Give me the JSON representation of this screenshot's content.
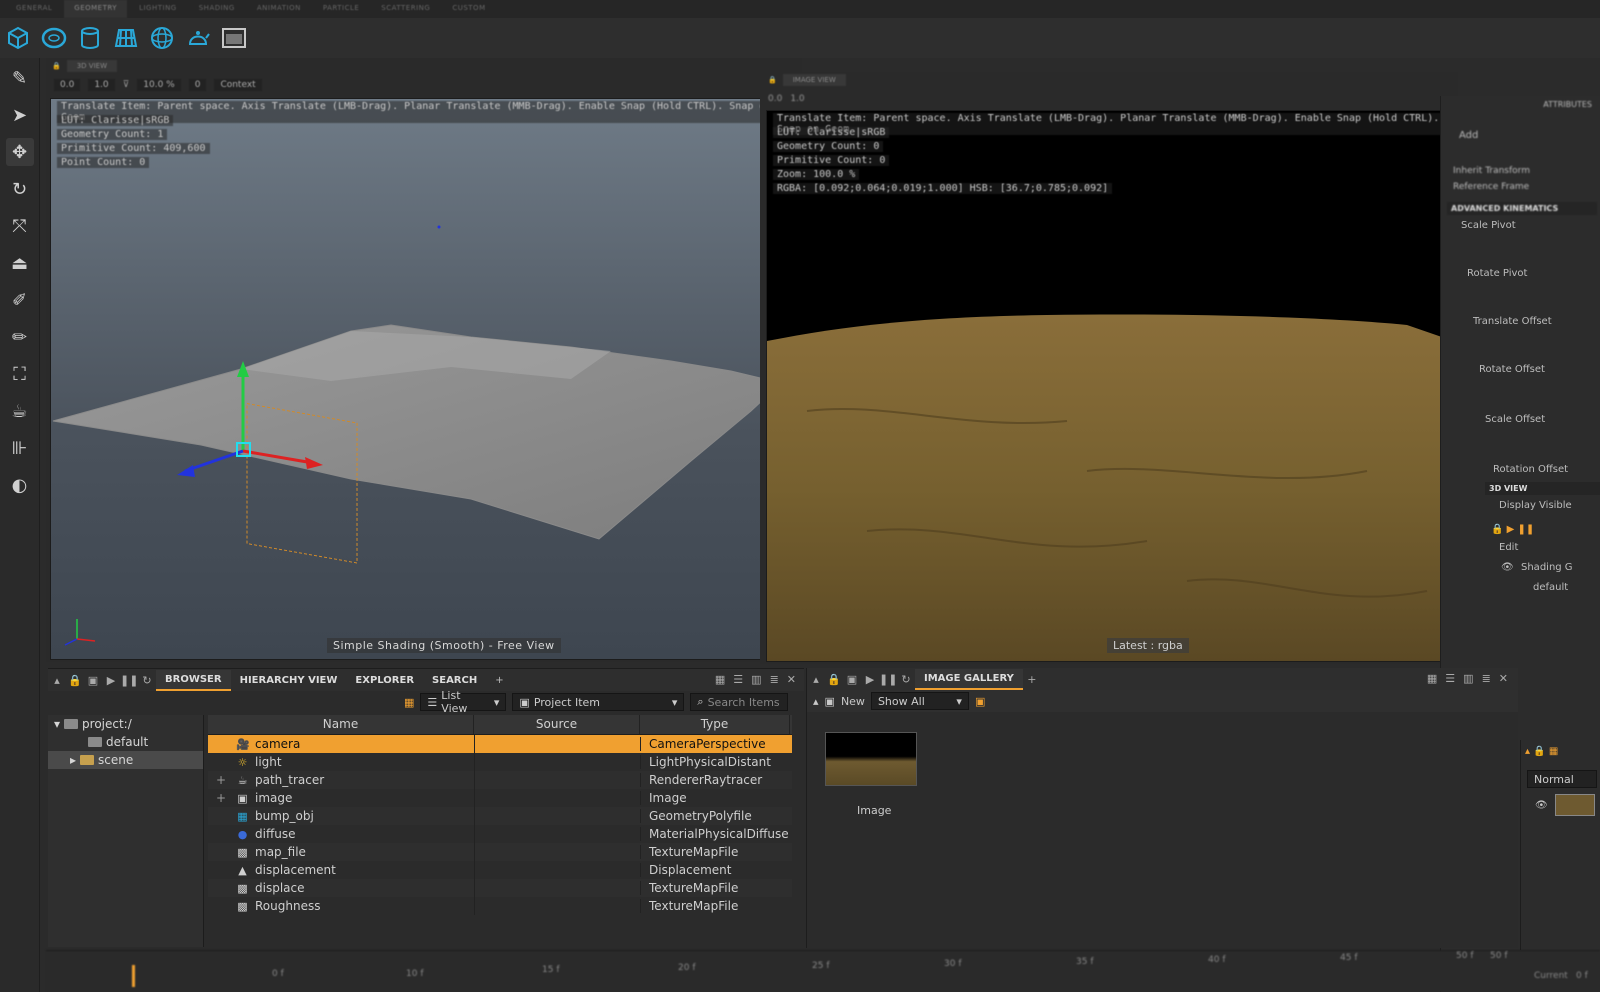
{
  "shelf_tabs": [
    "GENERAL",
    "GEOMETRY",
    "LIGHTING",
    "SHADING",
    "ANIMATION",
    "PARTICLE",
    "SCATTERING",
    "CUSTOM"
  ],
  "shelf_icons": [
    "cube-icon",
    "torus-icon",
    "cylinder-icon",
    "grid-icon",
    "sphere-icon",
    "teapot-icon",
    "render-icon"
  ],
  "left_tools": [
    "pen-icon",
    "select-arrow-icon",
    "move-icon",
    "rotate-icon",
    "scale-icon",
    "stamp-icon",
    "paint-icon",
    "brush-icon",
    "frame-icon",
    "teapot-icon",
    "ruler-icon",
    "color-swatch-icon"
  ],
  "view3d": {
    "tab_label": "3D VIEW",
    "toolbar": {
      "value1": "0.0",
      "value2": "1.0",
      "zoom": "10.0 %",
      "frame": "0",
      "context": "Context"
    },
    "overlay": [
      "Translate Item: Parent space. Axis Translate (LMB-Drag). Planar Translate (MMB-Drag). Enable Snap (Hold CTRL). Snap on Geom",
      "LUT: Clarisse|sRGB",
      "Geometry Count: 1",
      "Primitive Count: 409,600",
      "Point Count: 0"
    ],
    "caption": "Simple Shading (Smooth) - Free View"
  },
  "viewimg": {
    "tab_label": "IMAGE VIEW",
    "toolbar": {
      "value1": "0.0",
      "value2": "1.0"
    },
    "overlay": [
      "Translate Item: Parent space. Axis Translate (LMB-Drag). Planar Translate (MMB-Drag). Enable Snap (Hold CTRL). Snap on Geom",
      "LUT: Clarisse|sRGB",
      "Geometry Count: 0",
      "Primitive Count: 0",
      "Zoom: 100.0 %",
      "RGBA: [0.092;0.064;0.019;1.000] HSB: [36.7;0.785;0.092]"
    ],
    "caption": "Latest : rgba"
  },
  "attributes": {
    "header": "ATTRIBUTES",
    "add_label": "Add",
    "inherit": "Inherit Transform",
    "reference": "Reference Frame",
    "section_adv": "ADVANCED KINEMATICS",
    "scale_pivot": "Scale Pivot",
    "rotate_pivot": "Rotate Pivot",
    "translate_offset": "Translate Offset",
    "rotate_offset": "Rotate Offset",
    "scale_offset": "Scale Offset",
    "rotation_offset": "Rotation Offset",
    "section_3d": "3D VIEW",
    "display_visible": "Display Visible",
    "edit_label": "Edit",
    "shading_label": "Shading G",
    "default_label": "default"
  },
  "browser": {
    "tabs": [
      "BROWSER",
      "HIERARCHY VIEW",
      "EXPLORER",
      "SEARCH"
    ],
    "add_tab": "+",
    "list_view": "List View",
    "project_item": "Project Item",
    "search_placeholder": "Search Items",
    "tree": [
      {
        "label": "project:/",
        "indent": 0
      },
      {
        "label": "default",
        "indent": 1
      },
      {
        "label": "scene",
        "indent": 1
      }
    ],
    "columns": [
      "Name",
      "Source",
      "Type"
    ],
    "rows": [
      {
        "icon": "camera-icon",
        "name": "camera",
        "type": "CameraPerspective",
        "selected": true,
        "expand": false
      },
      {
        "icon": "light-icon",
        "name": "light",
        "type": "LightPhysicalDistant",
        "selected": false,
        "expand": false
      },
      {
        "icon": "teapot-icon",
        "name": "path_tracer",
        "type": "RendererRaytracer",
        "selected": false,
        "expand": true
      },
      {
        "icon": "image-icon",
        "name": "image",
        "type": "Image",
        "selected": false,
        "expand": true
      },
      {
        "icon": "building-icon",
        "name": "bump_obj",
        "type": "GeometryPolyfile",
        "selected": false,
        "expand": false
      },
      {
        "icon": "sphere-icon",
        "name": "diffuse",
        "type": "MaterialPhysicalDiffuse",
        "selected": false,
        "expand": false
      },
      {
        "icon": "texture-icon",
        "name": "map_file",
        "type": "TextureMapFile",
        "selected": false,
        "expand": false
      },
      {
        "icon": "displacement-icon",
        "name": "displacement",
        "type": "Displacement",
        "selected": false,
        "expand": false
      },
      {
        "icon": "texture-icon",
        "name": "displace",
        "type": "TextureMapFile",
        "selected": false,
        "expand": false
      },
      {
        "icon": "texture-icon",
        "name": "Roughness",
        "type": "TextureMapFile",
        "selected": false,
        "expand": false
      }
    ]
  },
  "gallery": {
    "tab_label": "IMAGE GALLERY",
    "add_tab": "+",
    "new_label": "New",
    "show_all": "Show All",
    "thumb_label": "Image"
  },
  "layers": {
    "blend_mode": "Normal"
  },
  "timeline": {
    "ticks": [
      "0 f",
      "10 f",
      "15 f",
      "20 f",
      "25 f",
      "30 f",
      "35 f",
      "40 f",
      "45 f",
      "50 f"
    ],
    "end_frame": "50 f",
    "current_label": "Current",
    "current_value": "0 f"
  },
  "colors": {
    "accent": "#f0a030",
    "selection": "#f0a030",
    "icon_blue": "#2aa8d8"
  }
}
